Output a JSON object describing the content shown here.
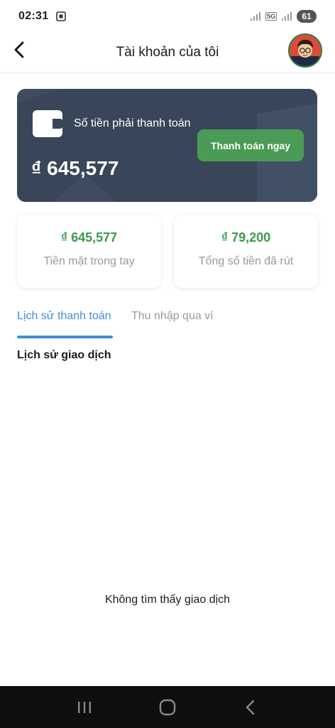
{
  "status_bar": {
    "time": "02:31",
    "network": "5G",
    "battery": "61"
  },
  "header": {
    "title": "Tài khoản của tôi"
  },
  "balance_card": {
    "label": "Số tiền phải thanh toán",
    "amount": "₫ 645,577",
    "pay_button": "Thanh toán ngay"
  },
  "stats": [
    {
      "value": "₫ 645,577",
      "label": "Tiền mặt trong tay"
    },
    {
      "value": "₫ 79,200",
      "label": "Tổng số tiền đã rút"
    }
  ],
  "tabs": [
    {
      "label": "Lịch sử thanh toán",
      "active": true
    },
    {
      "label": "Thu nhập qua ví",
      "active": false
    }
  ],
  "section_title": "Lịch sử giao dịch",
  "empty_message": "Không tìm thấy giao dịch",
  "icons": {
    "back": "back-arrow-icon",
    "wallet": "wallet-icon",
    "avatar": "avatar",
    "nav_recent": "recent-apps-icon",
    "nav_home": "home-icon",
    "nav_back": "nav-back-icon"
  },
  "colors": {
    "card_bg": "#394659",
    "accent_green": "#4a9b55",
    "value_green": "#3c9a4a",
    "tab_active": "#3d8fd8",
    "muted": "#9a9a9a"
  }
}
